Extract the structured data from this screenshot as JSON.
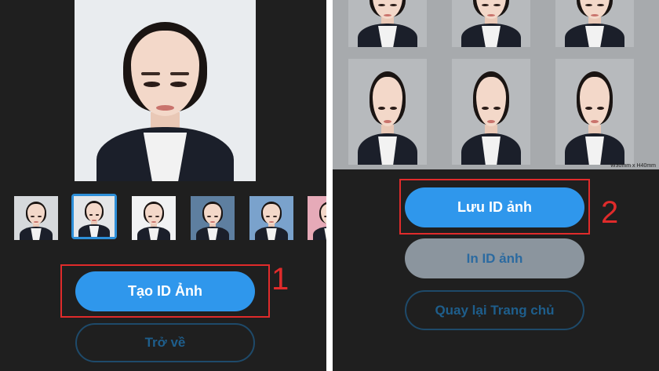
{
  "left": {
    "primary_button": "Tạo ID Ảnh",
    "secondary_button": "Trở về",
    "step_number": "1",
    "thumbnails": [
      {
        "bg": "#d6d9dc"
      },
      {
        "bg": "#e4e6e8",
        "selected": true
      },
      {
        "bg": "#f1f2f3"
      },
      {
        "bg": "#5e7fa0"
      },
      {
        "bg": "#7aa2cc"
      },
      {
        "bg": "#e6aab8"
      }
    ]
  },
  "right": {
    "save_button": "Lưu ID ảnh",
    "print_button": "In ID ảnh",
    "home_button": "Quay lại Trang chủ",
    "step_number": "2",
    "sheet_caption": "W30mm x H40mm"
  },
  "colors": {
    "background": "#1f1f1f",
    "primary": "#2f97ec",
    "highlight": "#e02b2b",
    "outline": "#1e4a6a"
  }
}
